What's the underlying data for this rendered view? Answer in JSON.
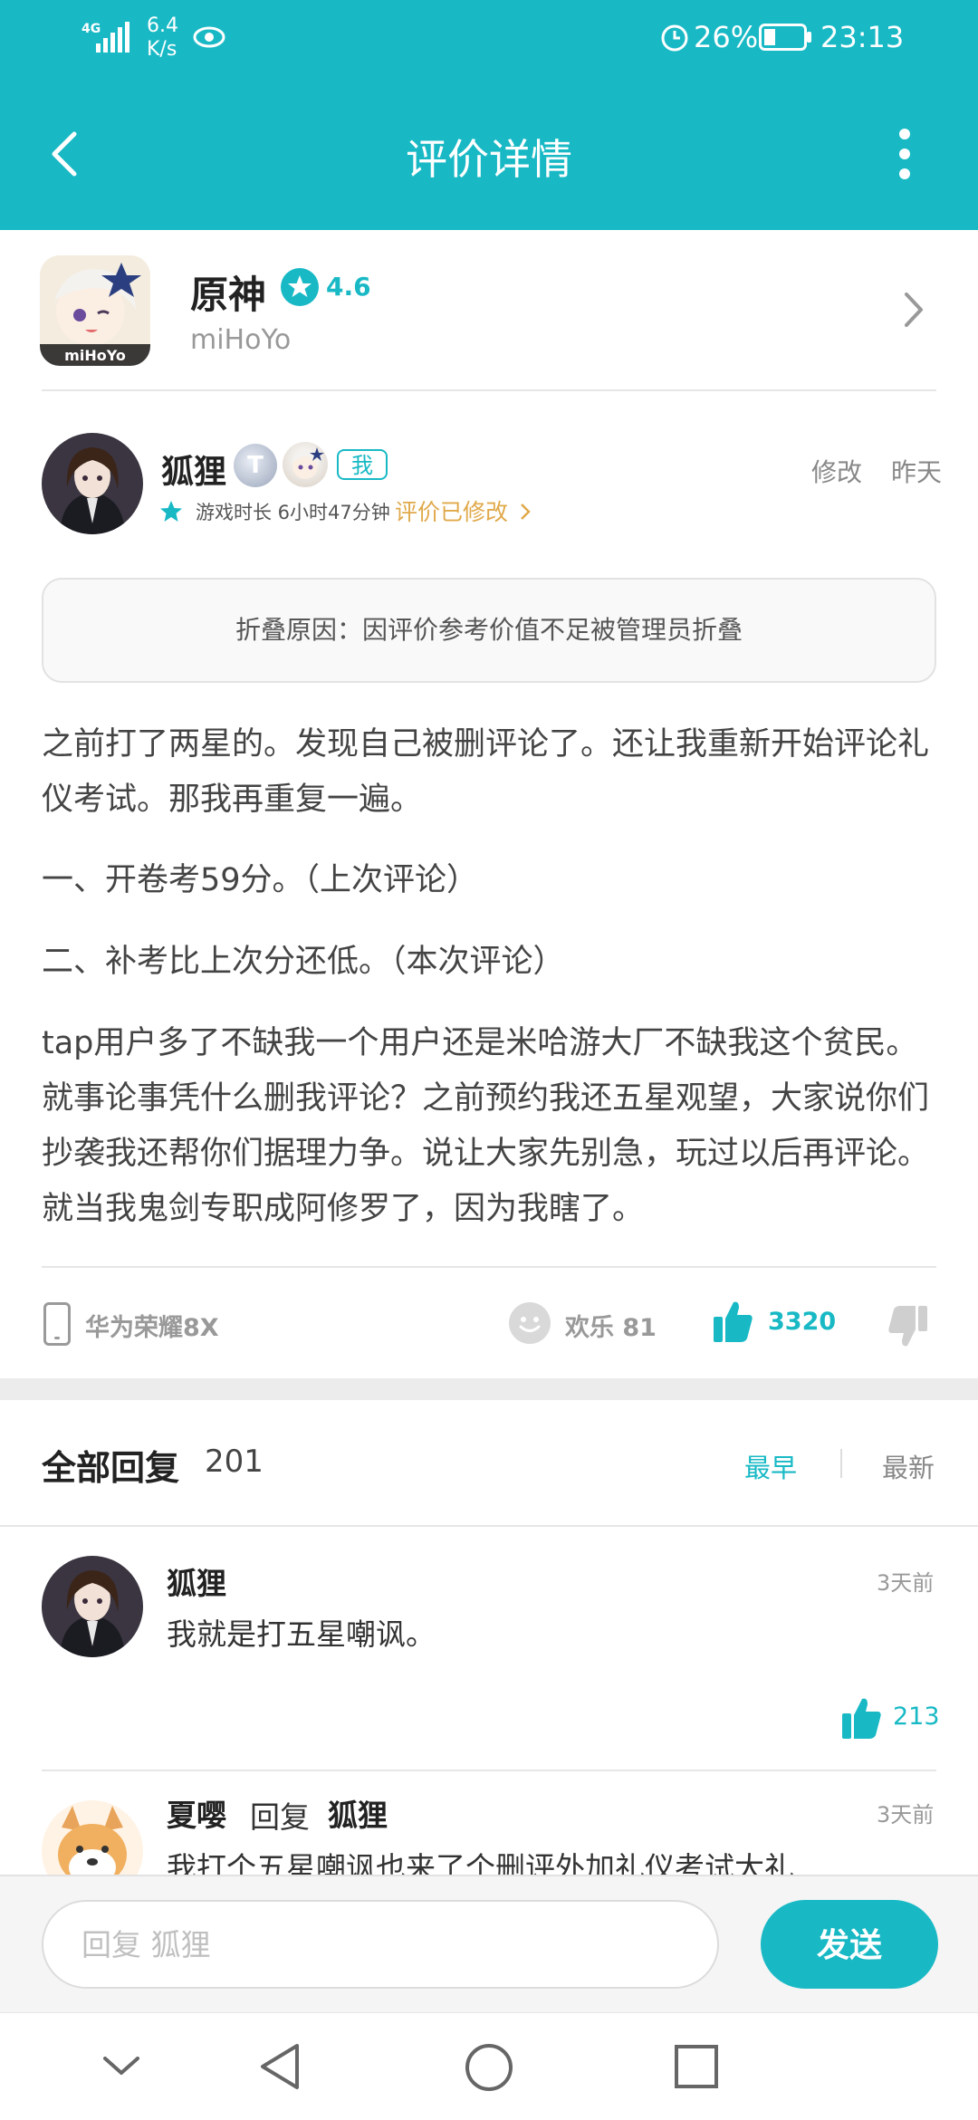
{
  "status_bar": {
    "network": "4G",
    "speed_value": "6.4",
    "speed_unit": "K/s",
    "battery": "26%",
    "time": "23:13"
  },
  "header": {
    "title": "评价详情"
  },
  "app": {
    "name": "原神",
    "rating": "4.6",
    "developer": "miHoYo",
    "icon_label": "miHoYo"
  },
  "review": {
    "author": "狐狸",
    "level_badge": "T",
    "me_tag": "我",
    "playtime": "游戏时长 6小时47分钟",
    "modified_link": "评价已修改",
    "edit_label": "修改",
    "time": "昨天",
    "fold_notice": "折叠原因：因评价参考价值不足被管理员折叠",
    "paragraphs": [
      "之前打了两星的。发现自己被删评论了。还让我重新开始评论礼仪考试。那我再重复一遍。",
      "一、开卷考59分。（上次评论）",
      "二、补考比上次分还低。（本次评论）",
      "tap用户多了不缺我一个用户还是米哈游大厂不缺我这个贫民。就事论事凭什么删我评论？之前预约我还五星观望，大家说你们抄袭我还帮你们据理力争。说让大家先别急，玩过以后再评论。就当我鬼剑专职成阿修罗了，因为我瞎了。"
    ],
    "device": "华为荣耀8X",
    "fun_label": "欢乐 81",
    "likes": "3320"
  },
  "replies": {
    "title": "全部回复",
    "count": "201",
    "sort_earliest": "最早",
    "sort_latest": "最新",
    "items": [
      {
        "author": "狐狸",
        "time": "3天前",
        "text": "我就是打五星嘲讽。",
        "likes": "213"
      },
      {
        "author": "夏嘤",
        "reply_word": "回复",
        "reply_to": "狐狸",
        "time": "3天前",
        "text": "我打个五星嘲讽也来了个删评外加礼仪考试大礼"
      }
    ]
  },
  "composer": {
    "placeholder": "回复 狐狸",
    "send_label": "发送"
  },
  "colors": {
    "accent": "#18b9c5",
    "warning": "#e0a94a"
  }
}
